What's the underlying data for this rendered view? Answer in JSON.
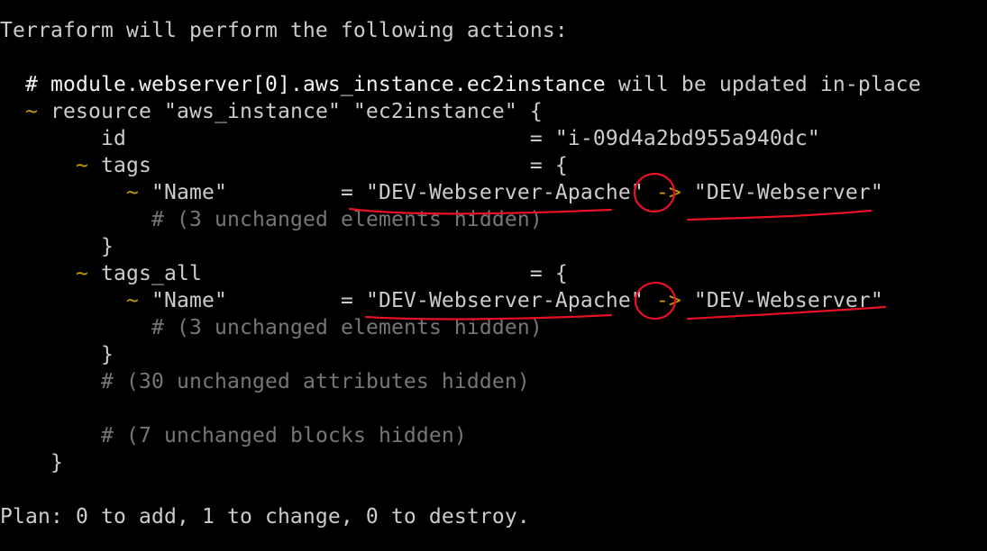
{
  "terminal": {
    "header": "Terraform will perform the following actions:",
    "resource_comment": "# module.webserver[0].aws_instance.ec2instance",
    "resource_comment_suffix": " will be updated in-place",
    "tilde": "~",
    "resource_line": "resource \"aws_instance\" \"ec2instance\" {",
    "id_line": "id                                = \"i-09d4a2bd955a940dc\"",
    "tags_line": "tags                              = {",
    "tags_all_line": "tags_all                          = {",
    "name_key": "\"Name\"         = ",
    "old_value": "\"DEV-Webserver-Apache\"",
    "arrow": "->",
    "new_value": "\"DEV-Webserver\"",
    "unchanged_elements": "# (3 unchanged elements hidden)",
    "close_brace": "}",
    "unchanged_attributes": "# (30 unchanged attributes hidden)",
    "unchanged_blocks": "# (7 unchanged blocks hidden)",
    "plan": "Plan: 0 to add, 1 to change, 0 to destroy."
  },
  "colors": {
    "background": "#000000",
    "text": "#cccccc",
    "bold_text": "#f2f2f2",
    "dim_text": "#767676",
    "change_marker": "#c19c00",
    "annotation": "#e81123"
  }
}
